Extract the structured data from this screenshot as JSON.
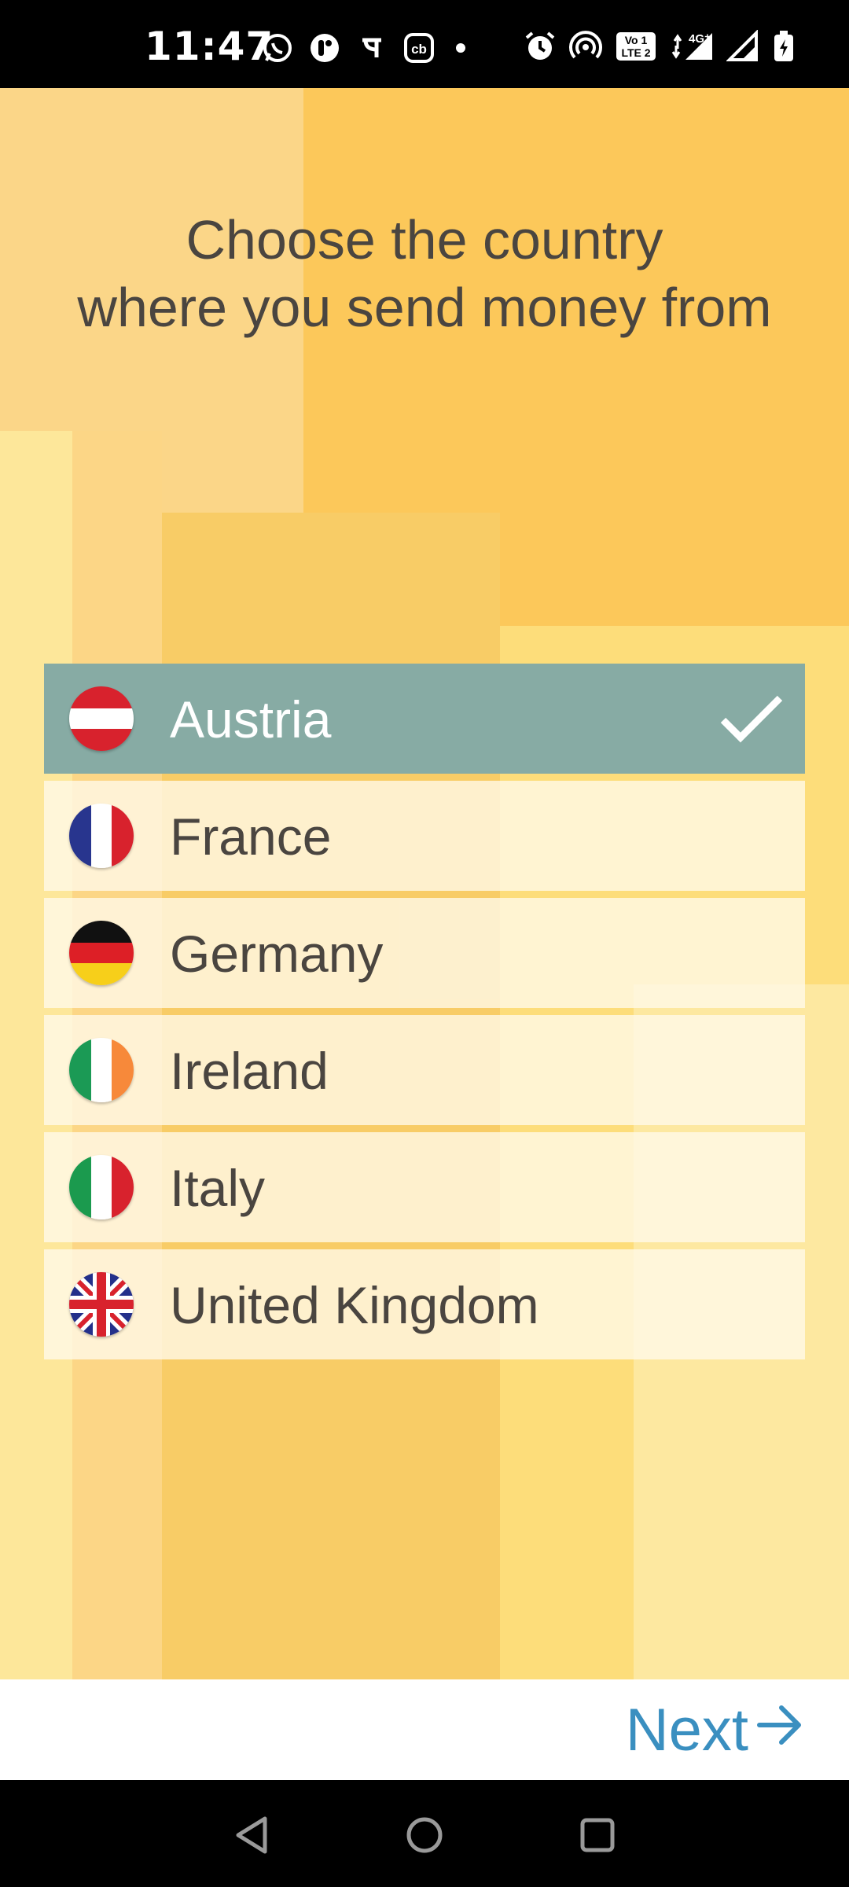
{
  "status_bar": {
    "time": "11:47",
    "icons_left": [
      "whatsapp-icon",
      "notification-icon",
      "phonepe-icon",
      "cb-icon"
    ],
    "icons_right": [
      "alarm-icon",
      "hotspot-icon",
      "volte-icon",
      "network-4g-icon",
      "signal-icon",
      "battery-charging-icon"
    ]
  },
  "header": {
    "title_line1": "Choose the country",
    "title_line2": "where you send money from"
  },
  "countries": [
    {
      "label": "Austria",
      "flag": "austria-flag-icon",
      "selected": true
    },
    {
      "label": "France",
      "flag": "france-flag-icon",
      "selected": false
    },
    {
      "label": "Germany",
      "flag": "germany-flag-icon",
      "selected": false
    },
    {
      "label": "Ireland",
      "flag": "ireland-flag-icon",
      "selected": false
    },
    {
      "label": "Italy",
      "flag": "italy-flag-icon",
      "selected": false
    },
    {
      "label": "United Kingdom",
      "flag": "uk-flag-icon",
      "selected": false
    }
  ],
  "footer": {
    "next_label": "Next"
  },
  "colors": {
    "accent": "#3a8fc0",
    "selected_row": "#87aba4",
    "background": "#fcc85a"
  }
}
